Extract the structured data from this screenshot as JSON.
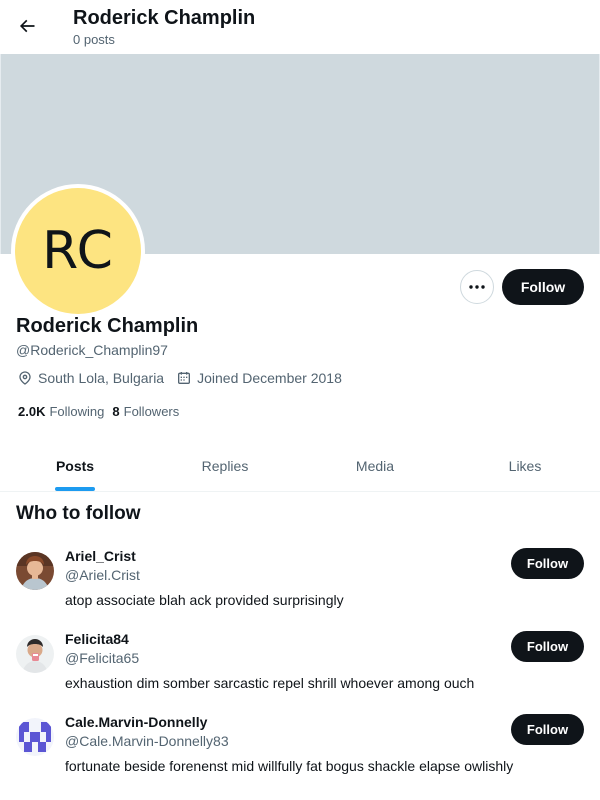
{
  "colors": {
    "banner": "#cfd9de",
    "avatar_bg": "#fde481",
    "accent": "#1d9bf0",
    "button_bg": "#0f1419"
  },
  "header": {
    "title": "Roderick Champlin",
    "subtitle": "0 posts",
    "back_icon": "arrow-left-icon"
  },
  "profile": {
    "initials": "RC",
    "name": "Roderick Champlin",
    "handle": "@Roderick_Champlin97",
    "location": "South Lola, Bulgaria",
    "joined": "Joined December 2018",
    "following_count": "2.0K",
    "following_label": "Following",
    "followers_count": "8",
    "followers_label": "Followers",
    "follow_label": "Follow",
    "more_label": "···"
  },
  "tabs": [
    {
      "label": "Posts",
      "active": true
    },
    {
      "label": "Replies",
      "active": false
    },
    {
      "label": "Media",
      "active": false
    },
    {
      "label": "Likes",
      "active": false
    }
  ],
  "who_to_follow": {
    "title": "Who to follow",
    "items": [
      {
        "name": "Ariel_Crist",
        "handle": "@Ariel.Crist",
        "bio": "atop associate blah ack provided surprisingly",
        "follow_label": "Follow",
        "avatar": "photo-avatar-man"
      },
      {
        "name": "Felicita84",
        "handle": "@Felicita65",
        "bio": "exhaustion dim somber sarcastic repel shrill whoever among ouch",
        "follow_label": "Follow",
        "avatar": "photo-avatar-person-drinking"
      },
      {
        "name": "Cale.Marvin-Donnelly",
        "handle": "@Cale.Marvin-Donnelly83",
        "bio": "fortunate beside forenenst mid willfully fat bogus shackle elapse owlishly",
        "follow_label": "Follow",
        "avatar": "identicon-avatar"
      }
    ]
  }
}
